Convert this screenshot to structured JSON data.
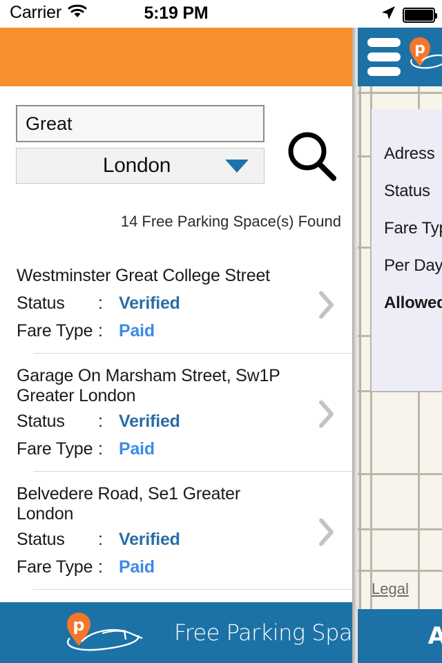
{
  "status_bar": {
    "carrier": "Carrier",
    "wifi_icon": "wifi-icon",
    "time": "5:19 PM",
    "location_icon": "location-arrow-icon",
    "battery_icon": "battery-full-icon"
  },
  "header": {
    "accent_color": "#F9902F"
  },
  "search": {
    "query_value": "Great",
    "query_placeholder": "",
    "city_value": "London",
    "city_options": [
      "London"
    ],
    "dropdown_icon": "chevron-down-icon",
    "search_icon": "search-icon"
  },
  "results": {
    "count_text": "14 Free Parking Space(s) Found",
    "status_label": "Status",
    "fare_label": "Fare Type",
    "colon": ":",
    "chevron_icon": "chevron-right-icon",
    "items": [
      {
        "title": "Westminster Great College Street",
        "status": "Verified",
        "fare_type": "Paid"
      },
      {
        "title": "Garage On Marsham Street, Sw1P Greater London",
        "status": "Verified",
        "fare_type": "Paid"
      },
      {
        "title": "Belvedere Road, Se1 Greater London",
        "status": "Verified",
        "fare_type": "Paid"
      }
    ]
  },
  "footer": {
    "brand_text": "Free Parking Space",
    "logo_icon": "parking-pin-logo-icon",
    "background_color": "#1C72A6"
  },
  "background_screen": {
    "menu_icon": "hamburger-menu-icon",
    "logo_icon": "parking-pin-logo-icon",
    "info_card": {
      "rows": [
        {
          "label": "Adress",
          "bold": false
        },
        {
          "label": "Status",
          "bold": false
        },
        {
          "label": "Fare Type",
          "bold": false
        },
        {
          "label": "Per Day",
          "bold": false
        },
        {
          "label": "Allowed V",
          "bold": true
        }
      ]
    },
    "legal_link": "Legal",
    "bottom_text": "A"
  },
  "colors": {
    "orange": "#F9902F",
    "blue": "#1C72A6",
    "verified_blue": "#2A6DA6",
    "paid_blue": "#3C8BE8",
    "map_bg": "#F7F4EC",
    "map_line": "#BDB7AB",
    "info_card_bg": "#ECEDF6"
  }
}
